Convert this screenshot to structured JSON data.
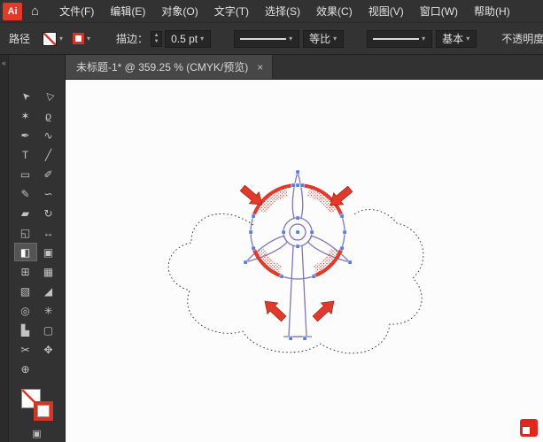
{
  "app": {
    "logo": "Ai"
  },
  "icons": {
    "home": "⌂",
    "collapse": "«",
    "caret": "▾",
    "stepper_up": "▲",
    "stepper_down": "▼",
    "draw_mode": "▣",
    "tab_close": "×"
  },
  "menubar": {
    "items": [
      "文件(F)",
      "编辑(E)",
      "对象(O)",
      "文字(T)",
      "选择(S)",
      "效果(C)",
      "视图(V)",
      "窗口(W)",
      "帮助(H)"
    ]
  },
  "control_bar": {
    "context": "路径",
    "stroke_label": "描边：",
    "stroke_width": "0.5 pt",
    "profile_label": "等比",
    "brush_label": "基本",
    "opacity_label": "不透明度："
  },
  "document_tab": {
    "title": "未标题-1* @ 359.25 % (CMYK/预览)"
  },
  "tools": [
    {
      "name": "selection-tool",
      "glyph": "➤"
    },
    {
      "name": "direct-selection-tool",
      "glyph": "▷"
    },
    {
      "name": "magic-wand-tool",
      "glyph": "✶"
    },
    {
      "name": "lasso-tool",
      "glyph": "ϱ"
    },
    {
      "name": "pen-tool",
      "glyph": "✒"
    },
    {
      "name": "curvature-tool",
      "glyph": "∿"
    },
    {
      "name": "type-tool",
      "glyph": "T"
    },
    {
      "name": "line-segment-tool",
      "glyph": "╱"
    },
    {
      "name": "rectangle-tool",
      "glyph": "▭"
    },
    {
      "name": "paintbrush-tool",
      "glyph": "✐"
    },
    {
      "name": "pencil-tool",
      "glyph": "✎"
    },
    {
      "name": "shaper-tool",
      "glyph": "∽"
    },
    {
      "name": "eraser-tool",
      "glyph": "▰"
    },
    {
      "name": "rotate-tool",
      "glyph": "↻"
    },
    {
      "name": "scale-tool",
      "glyph": "◱"
    },
    {
      "name": "width-tool",
      "glyph": "↔"
    },
    {
      "name": "shape-builder-tool",
      "glyph": "◧"
    },
    {
      "name": "free-transform-tool",
      "glyph": "▣"
    },
    {
      "name": "perspective-grid-tool",
      "glyph": "⊞"
    },
    {
      "name": "mesh-tool",
      "glyph": "▦"
    },
    {
      "name": "gradient-tool",
      "glyph": "▧"
    },
    {
      "name": "eyedropper-tool",
      "glyph": "◢"
    },
    {
      "name": "blend-tool",
      "glyph": "◎"
    },
    {
      "name": "symbol-sprayer-tool",
      "glyph": "✳"
    },
    {
      "name": "column-graph-tool",
      "glyph": "▙"
    },
    {
      "name": "artboard-tool",
      "glyph": "▢"
    },
    {
      "name": "slice-tool",
      "glyph": "✂"
    },
    {
      "name": "hand-tool",
      "glyph": "✥"
    },
    {
      "name": "zoom-tool",
      "glyph": "⊕"
    }
  ],
  "selected_tool": "shape-builder-tool",
  "colors": {
    "accent_red": "#e13a2b",
    "swatch_red": "#d33527",
    "artwork_purple": "#8274bd",
    "anchor_blue": "#4e7ce8",
    "ui_dark": "#323232",
    "canvas_bg": "#fcfcfc"
  }
}
